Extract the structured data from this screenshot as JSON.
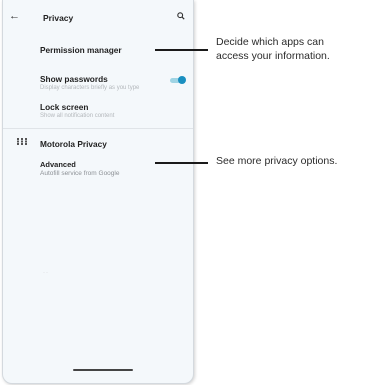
{
  "header": {
    "back_icon": "arrow-left-icon",
    "title": "Privacy",
    "search_icon": "search-icon"
  },
  "settings": {
    "permission_manager": "Permission manager",
    "show_passwords": {
      "title": "Show passwords",
      "subtitle": "Display characters briefly as you type",
      "toggle_on": true
    },
    "lock_screen": {
      "title": "Lock screen",
      "subtitle": "Show all notification content"
    },
    "motorola_privacy": {
      "icon": "grid-icon",
      "title": "Motorola Privacy"
    },
    "advanced": {
      "title": "Advanced",
      "subtitle": "Autofill service from Google"
    }
  },
  "callouts": {
    "permission": [
      "Decide which apps can",
      "access your information."
    ],
    "advanced": "See more privacy options."
  },
  "colors": {
    "accent": "#1a8fc0",
    "toggle_track": "#9fd4e4",
    "screen_bg": "#f4f8fb"
  }
}
